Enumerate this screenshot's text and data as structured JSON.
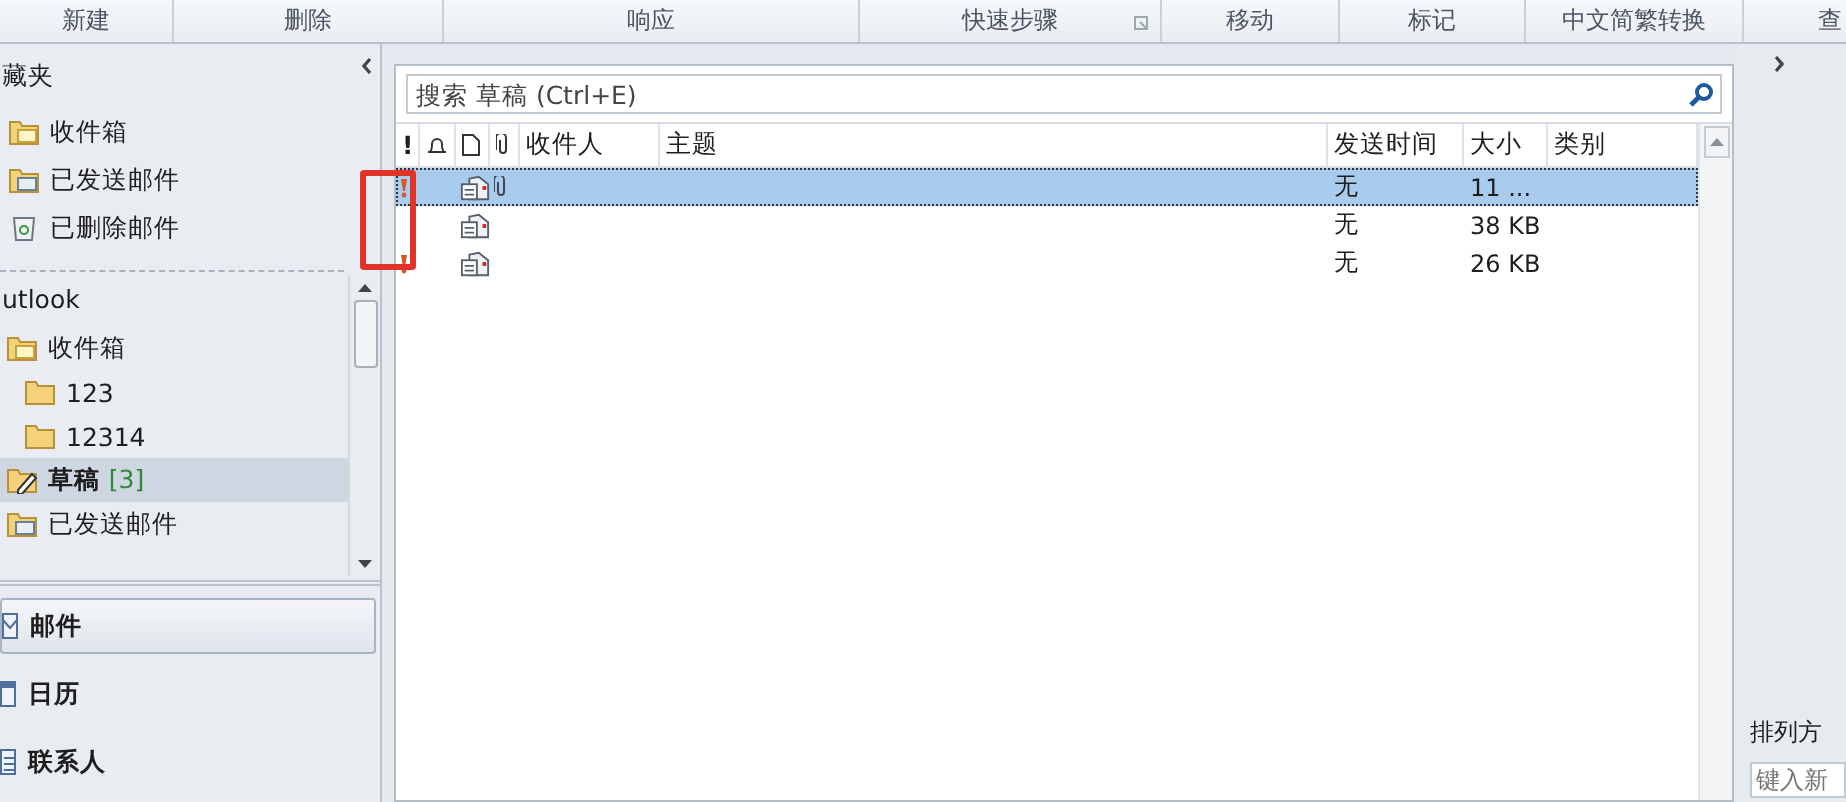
{
  "ribbon": {
    "groups": [
      {
        "label": "新建",
        "launcher": false
      },
      {
        "label": "删除",
        "launcher": false
      },
      {
        "label": "响应",
        "launcher": false
      },
      {
        "label": "快速步骤",
        "launcher": true
      },
      {
        "label": "移动",
        "launcher": false
      },
      {
        "label": "标记",
        "launcher": false
      },
      {
        "label": "中文简繁转换",
        "launcher": false
      },
      {
        "label": "查",
        "launcher": false
      }
    ]
  },
  "favorites": {
    "title": "藏夹",
    "items": [
      {
        "label": "收件箱",
        "kind": "inbox"
      },
      {
        "label": "已发送邮件",
        "kind": "sent"
      },
      {
        "label": "已删除邮件",
        "kind": "deleted"
      }
    ]
  },
  "mailbox": {
    "title": "utlook",
    "folders": [
      {
        "label": "收件箱",
        "kind": "inbox",
        "selected": false,
        "children": [
          {
            "label": "123",
            "kind": "folder",
            "selected": false
          },
          {
            "label": "12314",
            "kind": "folder",
            "selected": false
          }
        ]
      },
      {
        "label": "草稿",
        "count": "[3]",
        "kind": "drafts",
        "selected": true
      },
      {
        "label": "已发送邮件",
        "kind": "sent",
        "selected": false
      }
    ]
  },
  "nav_buttons": [
    {
      "label": "邮件",
      "kind": "mail",
      "selected": true
    },
    {
      "label": "日历",
      "kind": "calendar",
      "selected": false
    },
    {
      "label": "联系人",
      "kind": "contacts",
      "selected": false
    }
  ],
  "search": {
    "placeholder": "搜索 草稿 (Ctrl+E)"
  },
  "table": {
    "importance_header": "!",
    "columns": [
      "收件人",
      "主题",
      "发送时间",
      "大小",
      "类别"
    ],
    "rows": [
      {
        "important": true,
        "attachment": true,
        "selected": true,
        "sent": "无",
        "size": "11 ..."
      },
      {
        "important": false,
        "attachment": false,
        "selected": false,
        "sent": "无",
        "size": "38 KB"
      },
      {
        "important": true,
        "attachment": false,
        "selected": false,
        "sent": "无",
        "size": "26 KB"
      }
    ]
  },
  "right_pane": {
    "sort_label": "排列方",
    "input_placeholder": "键入新"
  }
}
